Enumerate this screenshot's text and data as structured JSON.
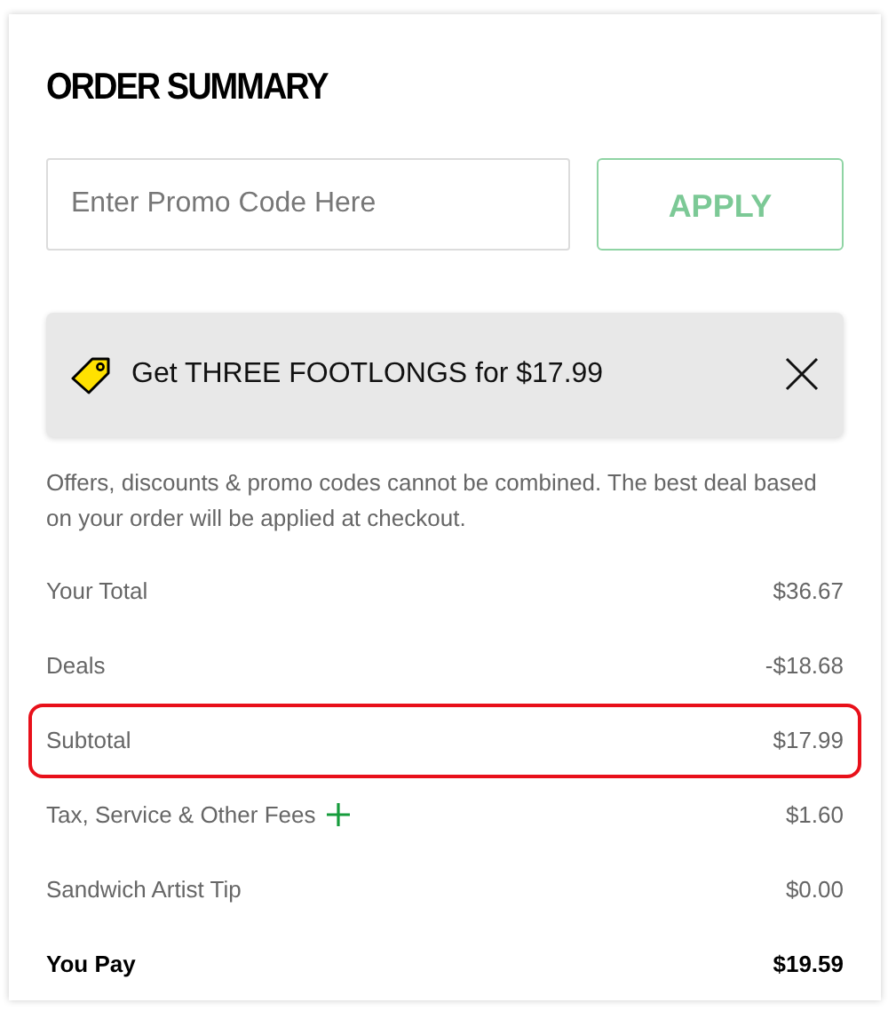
{
  "title": "ORDER SUMMARY",
  "promo": {
    "placeholder": "Enter Promo Code Here",
    "button": "APPLY"
  },
  "deal_banner": {
    "text": "Get THREE FOOTLONGS for $17.99"
  },
  "note": "Offers, discounts & promo codes cannot be combined. The best deal based on your order will be applied at checkout.",
  "lines": [
    {
      "kind": "line",
      "label": "Your Total",
      "value": "$36.67",
      "highlighted": false,
      "expandable": false
    },
    {
      "kind": "line",
      "label": "Deals",
      "value": "-$18.68",
      "highlighted": false,
      "expandable": false
    },
    {
      "kind": "line",
      "label": "Subtotal",
      "value": "$17.99",
      "highlighted": true,
      "expandable": false
    },
    {
      "kind": "line",
      "label": "Tax, Service & Other Fees",
      "value": "$1.60",
      "highlighted": false,
      "expandable": true
    },
    {
      "kind": "line",
      "label": "Sandwich Artist Tip",
      "value": "$0.00",
      "highlighted": false,
      "expandable": false
    },
    {
      "kind": "total",
      "label": "You Pay",
      "value": "$19.59",
      "highlighted": false,
      "expandable": false
    }
  ]
}
